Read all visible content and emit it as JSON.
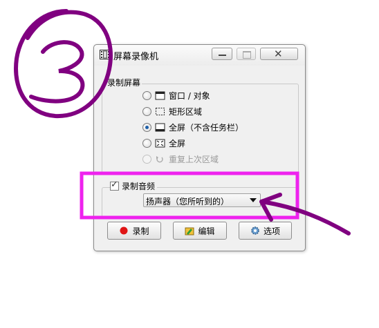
{
  "window": {
    "title": "屏幕录像机",
    "title_icon": "film-icon"
  },
  "screen_group": {
    "legend": "录制屏幕",
    "options": [
      {
        "label": "窗口 / 对象",
        "icon": "window-icon",
        "checked": false,
        "disabled": false
      },
      {
        "label": "矩形区域",
        "icon": "dashed-rect-icon",
        "checked": false,
        "disabled": false
      },
      {
        "label": "全屏（不含任务栏）",
        "icon": "screen-taskbar-icon",
        "checked": true,
        "disabled": false
      },
      {
        "label": "全屏",
        "icon": "fullscreen-icon",
        "checked": false,
        "disabled": false
      },
      {
        "label": "重复上次区域",
        "icon": "repeat-icon",
        "checked": false,
        "disabled": true
      }
    ]
  },
  "audio_group": {
    "checkbox_label": "录制音频",
    "checked": true,
    "source_selected": "扬声器（您所听到的）"
  },
  "buttons": {
    "record": "录制",
    "edit": "编辑",
    "options": "选项"
  },
  "annotation": {
    "number": "3",
    "highlight_color": "#ee22ee",
    "ink_color": "#800080"
  }
}
